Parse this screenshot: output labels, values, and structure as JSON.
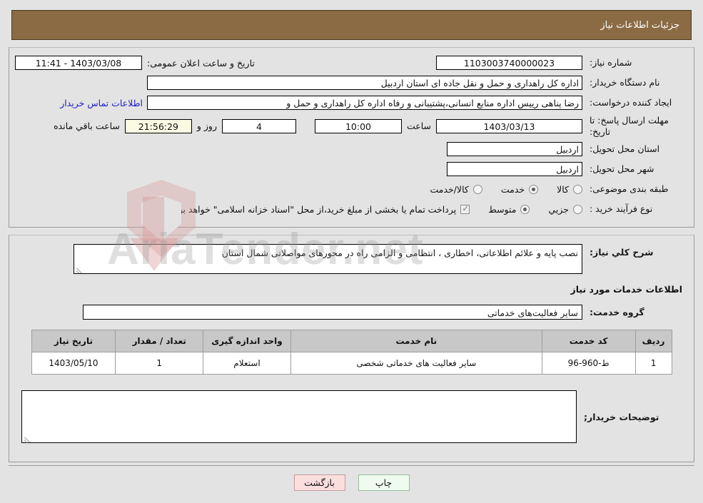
{
  "header": {
    "title": "جزئیات اطلاعات نیاز"
  },
  "form": {
    "need_number": {
      "label": "شماره نیاز:",
      "value": "1103003740000023"
    },
    "public_announce": {
      "label": "تاریخ و ساعت اعلان عمومی:",
      "value": "1403/03/08 - 11:41"
    },
    "buyer_org": {
      "label": "نام دستگاه خریدار:",
      "value": "اداره کل راهداری و حمل و نقل جاده ای استان اردبیل"
    },
    "requester": {
      "label": "ایجاد کننده درخواست:",
      "value": "رضا پناهی رییس اداره منابع انسانی،پشتیبانی و رفاه اداره کل راهداری و حمل و"
    },
    "contact_link": {
      "label": "اطلاعات تماس خریدار"
    },
    "deadline": {
      "label": "مهلت ارسال پاسخ: تا تاریخ:",
      "date": "1403/03/13",
      "hour_label": "ساعت",
      "hour": "10:00",
      "days": "4",
      "days_label": "روز و",
      "timer": "21:56:29",
      "remaining_label": "ساعت باقي مانده"
    },
    "province": {
      "label": "استان محل تحویل:",
      "value": "اردبیل"
    },
    "city": {
      "label": "شهر محل تحویل:",
      "value": "اردبیل"
    },
    "category": {
      "label": "طبقه بندی موضوعی:",
      "options": [
        {
          "label": "کالا",
          "checked": false
        },
        {
          "label": "خدمت",
          "checked": true
        },
        {
          "label": "کالا/خدمت",
          "checked": false
        }
      ]
    },
    "purchase_type": {
      "label": "نوع فرآیند خرید :",
      "options": [
        {
          "label": "جزیي",
          "checked": false
        },
        {
          "label": "متوسط",
          "checked": true
        }
      ],
      "treasury_checked": true,
      "treasury_note": "پرداخت تمام یا بخشی از مبلغ خرید،از محل \"اسناد خزانه اسلامی\" خواهد بود."
    }
  },
  "description": {
    "label": "شرح کلي نياز:",
    "value": "نصب پایه و علائم اطلاعاتی، اخطاری ، انتظامی و الزامی راه در محورهای مواصلاتی شمال استان"
  },
  "services_section": {
    "title": "اطلاعات خدمات مورد نیاز",
    "group": {
      "label": "گروه خدمت:",
      "value": "سایر فعالیت‌های خدماتی"
    }
  },
  "table": {
    "headers": [
      "ردیف",
      "کد خدمت",
      "نام خدمت",
      "واحد اندازه گیری",
      "تعداد / مقدار",
      "تاریخ نیاز"
    ],
    "rows": [
      {
        "radif": "1",
        "code": "ط-960-96",
        "name": "سایر فعالیت های خدماتی شخصی",
        "unit": "استعلام",
        "qty": "1",
        "date": "1403/05/10"
      }
    ]
  },
  "buyer_notes": {
    "label": "توضیحات خریدار;",
    "value": ""
  },
  "footer": {
    "print_label": "چاپ",
    "back_label": "بازگشت"
  },
  "watermark": {
    "text": "AriaTender.net"
  },
  "colors": {
    "header_bg": "#8b6b43",
    "page_bg": "#e3e3e3",
    "link": "#2020cc",
    "table_header_bg": "#c8c8c8",
    "timer_bg": "#fbfbe4",
    "print_btn": "#eefbee",
    "back_btn": "#fbdede"
  }
}
